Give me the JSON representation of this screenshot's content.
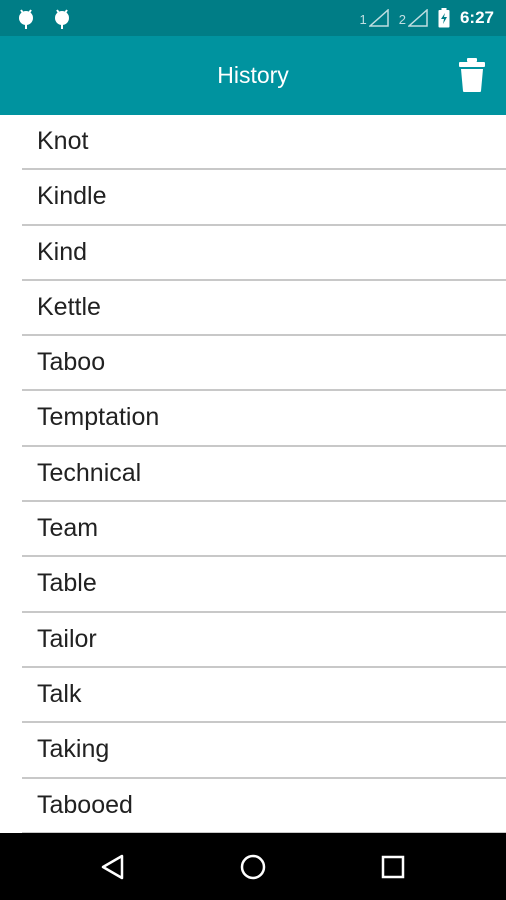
{
  "status_bar": {
    "sim1_label": "1",
    "sim2_label": "2",
    "time": "6:27"
  },
  "app_bar": {
    "title": "History",
    "delete_icon": "trash-icon"
  },
  "history": {
    "items": [
      "Knot",
      "Kindle",
      "Kind",
      "Kettle",
      "Taboo",
      "Temptation",
      "Technical",
      "Team",
      "Table",
      "Tailor",
      "Talk",
      "Taking",
      "Tabooed"
    ]
  },
  "nav_bar": {
    "back_icon": "back-triangle-icon",
    "home_icon": "home-circle-icon",
    "recents_icon": "recents-square-icon"
  },
  "colors": {
    "status_bar": "#007d86",
    "app_bar": "#00939f",
    "divider": "#c8c8c8",
    "text": "#212121"
  }
}
